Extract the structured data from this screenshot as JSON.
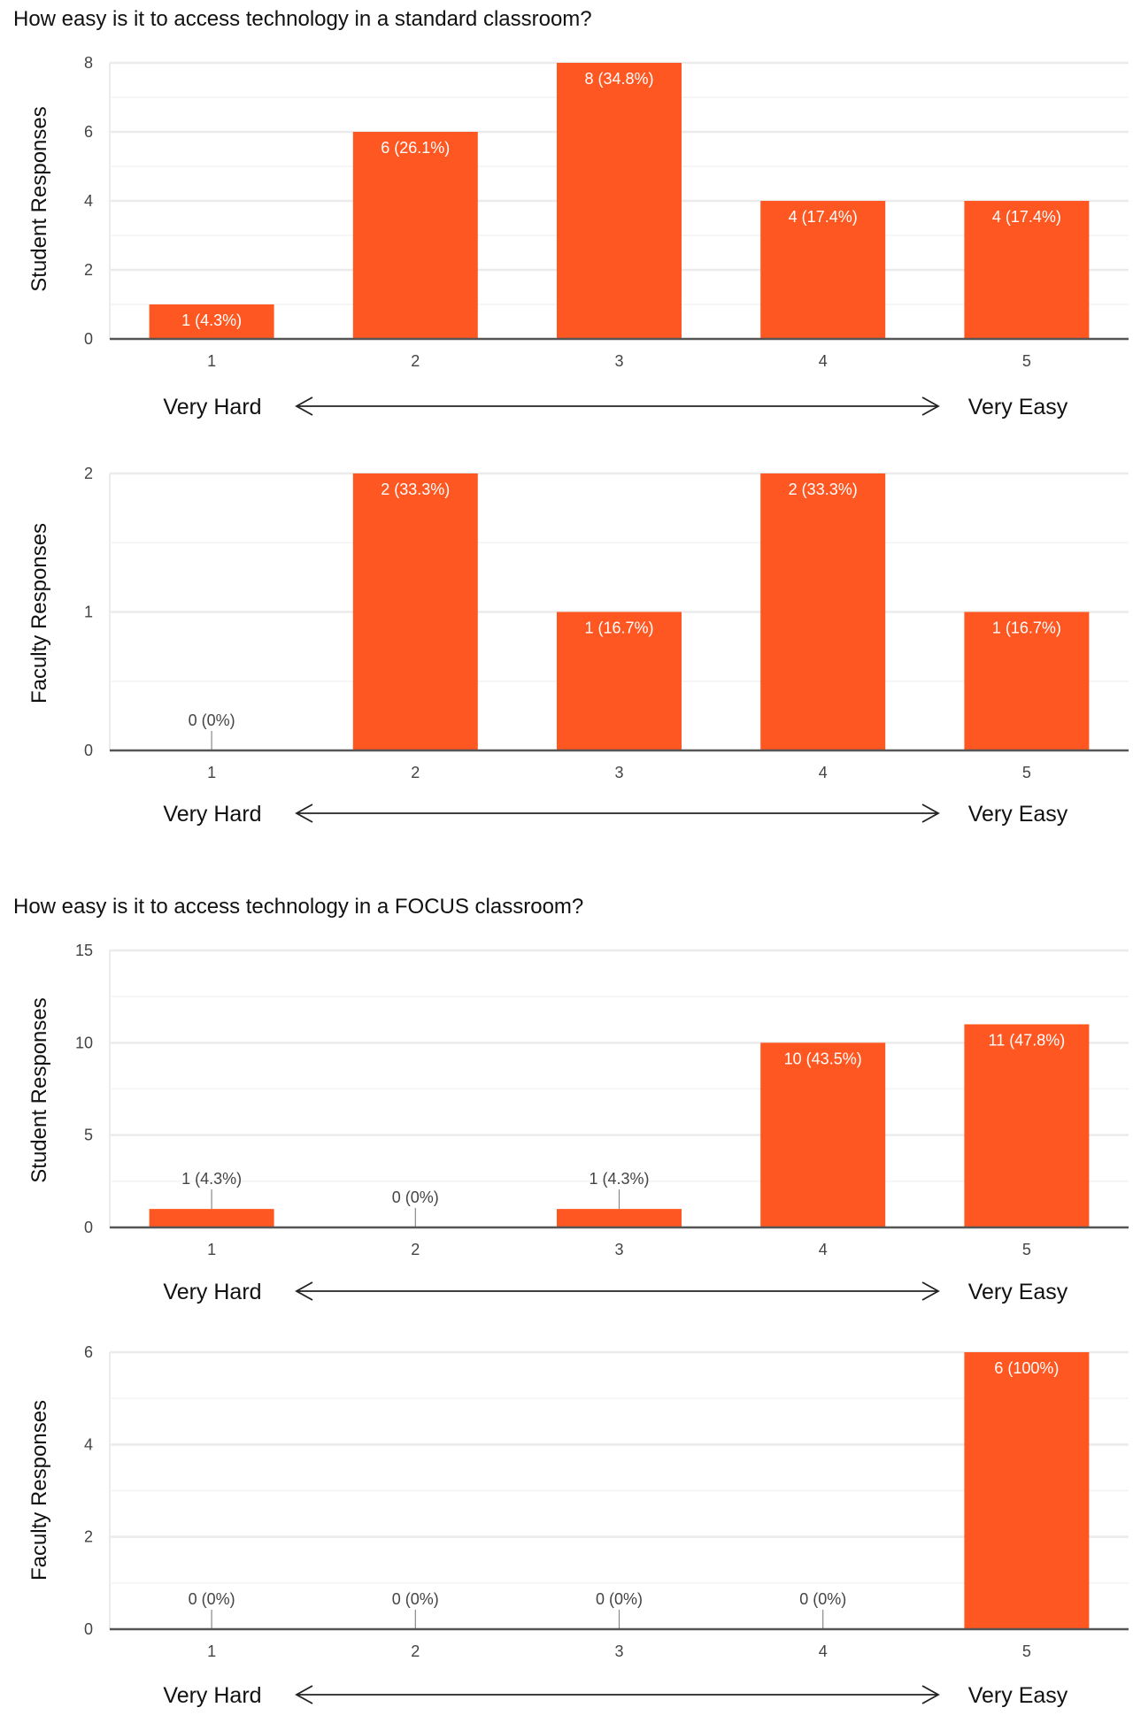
{
  "sections": [
    {
      "title": "How easy is it to access technology in a standard classroom?"
    },
    {
      "title": "How easy is it to access technology in a FOCUS classroom?"
    }
  ],
  "colors": {
    "bar": "#FF5722",
    "gridline": "#ebebeb",
    "axis": "#555555"
  },
  "chart_data": [
    {
      "type": "bar",
      "section": 0,
      "title": "How easy is it to access technology in a standard classroom?",
      "ylabel": "Student Responses",
      "xlabel": "",
      "categories": [
        "1",
        "2",
        "3",
        "4",
        "5"
      ],
      "values": [
        1,
        6,
        8,
        4,
        4
      ],
      "data_labels": [
        "1 (4.3%)",
        "6 (26.1%)",
        "8 (34.8%)",
        "4 (17.4%)",
        "4 (17.4%)"
      ],
      "ylim": [
        0,
        8
      ],
      "yticks": [
        0,
        2,
        4,
        6,
        8
      ],
      "minor_gridlines": [
        1,
        3,
        5,
        7
      ],
      "scale_low_label": "Very Hard",
      "scale_high_label": "Very Easy",
      "grid": true,
      "legend": "none"
    },
    {
      "type": "bar",
      "section": 0,
      "title": "How easy is it to access technology in a standard classroom?",
      "ylabel": "Faculty Responses",
      "xlabel": "",
      "categories": [
        "1",
        "2",
        "3",
        "4",
        "5"
      ],
      "values": [
        0,
        2,
        1,
        2,
        1
      ],
      "data_labels": [
        "0 (0%)",
        "2 (33.3%)",
        "1 (16.7%)",
        "2 (33.3%)",
        "1 (16.7%)"
      ],
      "ylim": [
        0,
        2
      ],
      "yticks": [
        0,
        1,
        2
      ],
      "minor_gridlines": [
        0.5,
        1.5
      ],
      "scale_low_label": "Very Hard",
      "scale_high_label": "Very Easy",
      "grid": true,
      "legend": "none"
    },
    {
      "type": "bar",
      "section": 1,
      "title": "How easy is it to access technology in a FOCUS classroom?",
      "ylabel": "Student Responses",
      "xlabel": "",
      "categories": [
        "1",
        "2",
        "3",
        "4",
        "5"
      ],
      "values": [
        1,
        0,
        1,
        10,
        11
      ],
      "data_labels": [
        "1 (4.3%)",
        "0 (0%)",
        "1 (4.3%)",
        "10 (43.5%)",
        "11 (47.8%)"
      ],
      "ylim": [
        0,
        15
      ],
      "yticks": [
        0,
        5,
        10,
        15
      ],
      "minor_gridlines": [
        2.5,
        7.5,
        12.5
      ],
      "scale_low_label": "Very Hard",
      "scale_high_label": "Very Easy",
      "grid": true,
      "legend": "none"
    },
    {
      "type": "bar",
      "section": 1,
      "title": "How easy is it to access technology in a FOCUS classroom?",
      "ylabel": "Faculty Responses",
      "xlabel": "",
      "categories": [
        "1",
        "2",
        "3",
        "4",
        "5"
      ],
      "values": [
        0,
        0,
        0,
        0,
        6
      ],
      "data_labels": [
        "0 (0%)",
        "0 (0%)",
        "0 (0%)",
        "0 (0%)",
        "6 (100%)"
      ],
      "ylim": [
        0,
        6
      ],
      "yticks": [
        0,
        2,
        4,
        6
      ],
      "minor_gridlines": [
        1,
        3,
        5
      ],
      "scale_low_label": "Very Hard",
      "scale_high_label": "Very Easy",
      "grid": true,
      "legend": "none"
    }
  ]
}
